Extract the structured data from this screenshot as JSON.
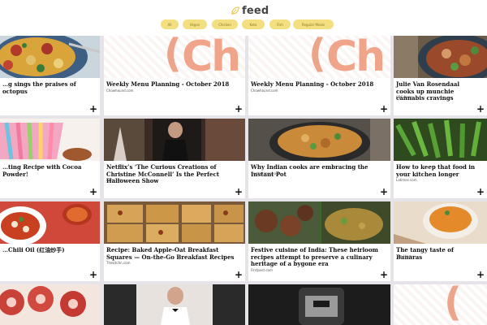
{
  "header": {
    "logo_text": "feed",
    "logo_icon": "leaf-icon"
  },
  "filters": [
    "All",
    "Vegan",
    "Chicken",
    "Keto",
    "Fish",
    "Regular Meals"
  ],
  "cards": [
    {
      "title": "…g sings the praises of octopus",
      "source": ""
    },
    {
      "title": "Weekly Menu Planning - October 2018",
      "source": "Chowhound.com"
    },
    {
      "title": "Weekly Menu Planning - October 2018",
      "source": "Chowhound.com"
    },
    {
      "title": "Julie Van Rosendaal cooks up munchie cannabis cravings",
      "source": "CBC News"
    },
    {
      "title": "…ting Recipe with Cocoa Powder!",
      "source": ""
    },
    {
      "title": "Netflix’s ‘The Curious Creations of Christine McConnell’ Is the Perfect Halloween Show",
      "source": "Eater.com"
    },
    {
      "title": "Why Indian cooks are embracing the Instant Pot",
      "source": "Seattletimes.com"
    },
    {
      "title": "How to keep that food in your kitchen longer",
      "source": "Latimes.com"
    },
    {
      "title": "…Chili Oil (红油炒手)",
      "source": ""
    },
    {
      "title": "Recipe: Baked Apple-Oat Breakfast Squares — On-the-Go Breakfast Recipes",
      "source": "Thekitchn.com"
    },
    {
      "title": "Festive cuisine of India: These heirloom recipes attempt to preserve a culinary heritage of a bygone era",
      "source": "Firstpost.com"
    },
    {
      "title": "The tangy taste of Banaras",
      "source": "The Hindu"
    }
  ],
  "colors": {
    "background": "#e6e4e9",
    "chip": "#f3df7f",
    "chowhound_accent": "#f0a58a"
  },
  "card_action_icon": "plus-icon"
}
